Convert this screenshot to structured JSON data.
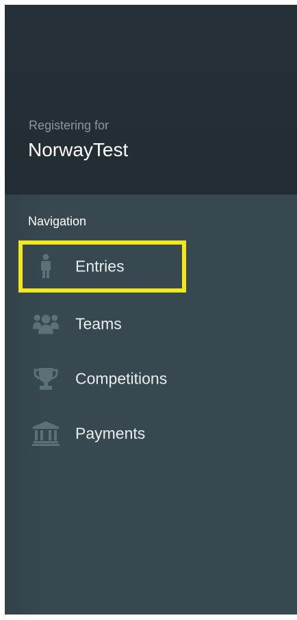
{
  "header": {
    "registering_label": "Registering for",
    "event_name": "NorwayTest"
  },
  "navigation": {
    "heading": "Navigation",
    "items": [
      {
        "label": "Entries",
        "icon": "person-icon",
        "active": true
      },
      {
        "label": "Teams",
        "icon": "group-icon",
        "active": false
      },
      {
        "label": "Competitions",
        "icon": "trophy-icon",
        "active": false
      },
      {
        "label": "Payments",
        "icon": "bank-icon",
        "active": false
      }
    ]
  },
  "colors": {
    "header_bg": "#252f36",
    "sidebar_bg": "#374850",
    "icon_color": "#5c7078",
    "highlight": "#f5e81a"
  }
}
